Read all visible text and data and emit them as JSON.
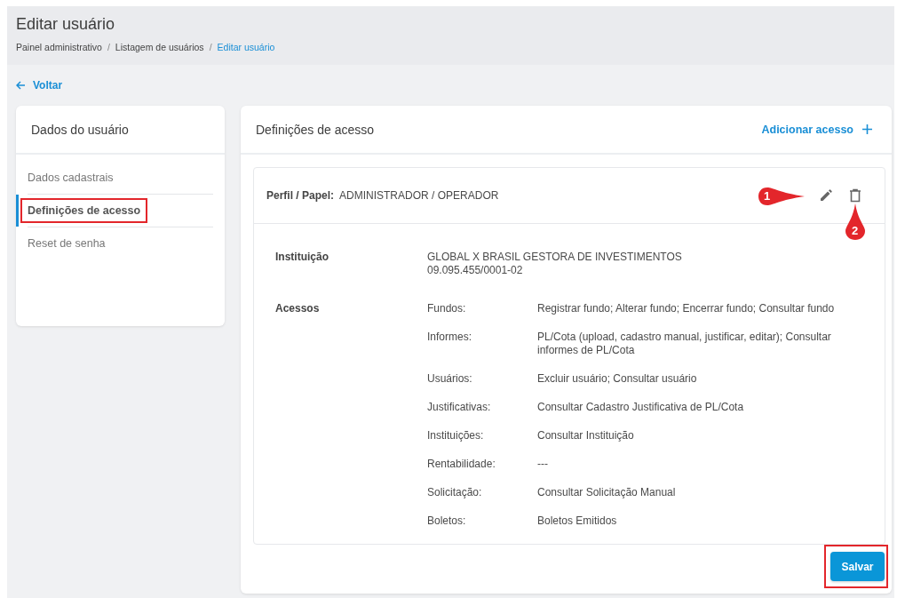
{
  "header": {
    "title": "Editar usuário",
    "breadcrumb": [
      {
        "label": "Painel administrativo",
        "current": false
      },
      {
        "label": "Listagem de usuários",
        "current": false
      },
      {
        "label": "Editar usuário",
        "current": true
      }
    ],
    "separators": [
      "/",
      "/"
    ]
  },
  "back_link": {
    "label": "Voltar"
  },
  "sidebar": {
    "title": "Dados do usuário",
    "items": [
      {
        "label": "Dados cadastrais",
        "selected": false,
        "annotated": false
      },
      {
        "label": "Definições de acesso",
        "selected": true,
        "annotated": true
      },
      {
        "label": "Reset de senha",
        "selected": false,
        "annotated": false
      }
    ]
  },
  "access_panel": {
    "title": "Definições de acesso",
    "add_link": "Adicionar acesso",
    "profile": {
      "label": "Perfil / Papel:",
      "value": "ADMINISTRADOR / OPERADOR",
      "actions": [
        {
          "kind": "edit",
          "callout": "1"
        },
        {
          "kind": "delete",
          "callout": "2"
        }
      ]
    },
    "institution": {
      "label": "Instituição",
      "name": "GLOBAL X BRASIL GESTORA DE INVESTIMENTOS",
      "cnpj": "09.095.455/0001-02"
    },
    "accesses": {
      "label": "Acessos",
      "rows": [
        {
          "module": "Fundos:",
          "permissions": "Registrar fundo; Alterar fundo; Encerrar fundo; Consultar fundo"
        },
        {
          "module": "Informes:",
          "permissions": "PL/Cota (upload, cadastro manual, justificar, editar); Consultar informes de PL/Cota"
        },
        {
          "module": "Usuários:",
          "permissions": "Excluir usuário; Consultar usuário"
        },
        {
          "module": "Justificativas:",
          "permissions": "Consultar Cadastro Justificativa de PL/Cota"
        },
        {
          "module": "Instituições:",
          "permissions": "Consultar Instituição"
        },
        {
          "module": "Rentabilidade:",
          "permissions": "---"
        },
        {
          "module": "Solicitação:",
          "permissions": "Consultar Solicitação Manual"
        },
        {
          "module": "Boletos:",
          "permissions": "Boletos Emitidos"
        }
      ]
    },
    "save_button": {
      "label": "Salvar",
      "annotated": true
    }
  }
}
